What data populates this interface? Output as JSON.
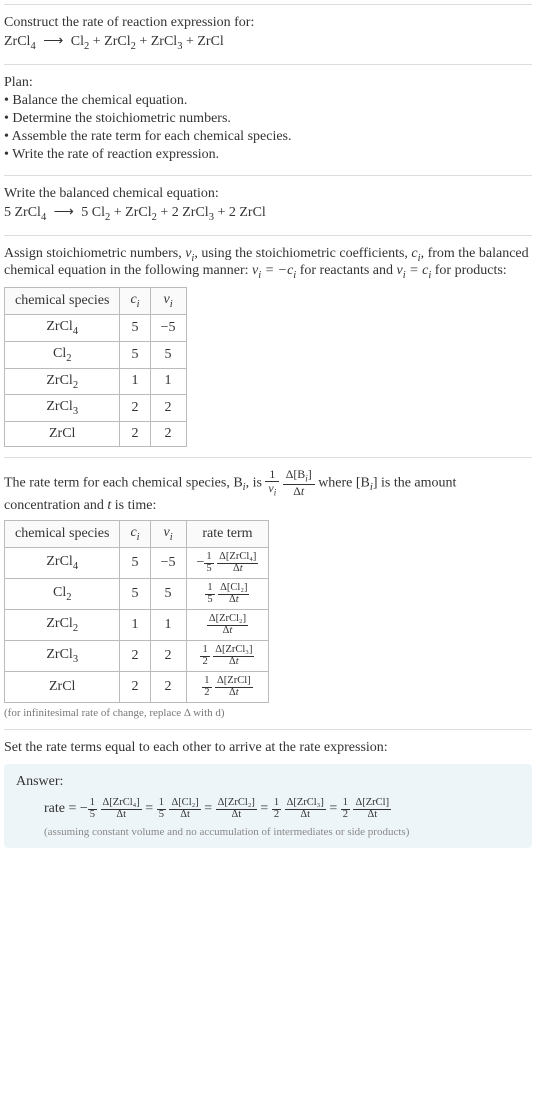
{
  "header": {
    "title": "Construct the rate of reaction expression for:",
    "equation_lhs": "ZrCl",
    "equation_rhs_parts": [
      "Cl",
      " + ZrCl",
      " + ZrCl",
      " + ZrCl"
    ]
  },
  "plan": {
    "title": "Plan:",
    "items": [
      "• Balance the chemical equation.",
      "• Determine the stoichiometric numbers.",
      "• Assemble the rate term for each chemical species.",
      "• Write the rate of reaction expression."
    ]
  },
  "balanced": {
    "title": "Write the balanced chemical equation:",
    "eq_text": "5 ZrCl₄  ⟶  5 Cl₂ + ZrCl₂ + 2 ZrCl₃ + 2 ZrCl"
  },
  "stoich": {
    "intro_a": "Assign stoichiometric numbers, ",
    "intro_b": ", using the stoichiometric coefficients, ",
    "intro_c": ", from the balanced chemical equation in the following manner: ",
    "intro_d": " for reactants and ",
    "intro_e": " for products:",
    "headers": [
      "chemical species",
      "cᵢ",
      "νᵢ"
    ],
    "rows": [
      {
        "species": "ZrCl",
        "sub": "4",
        "c": "5",
        "v": "−5"
      },
      {
        "species": "Cl",
        "sub": "2",
        "c": "5",
        "v": "5"
      },
      {
        "species": "ZrCl",
        "sub": "2",
        "c": "1",
        "v": "1"
      },
      {
        "species": "ZrCl",
        "sub": "3",
        "c": "2",
        "v": "2"
      },
      {
        "species": "ZrCl",
        "sub": "",
        "c": "2",
        "v": "2"
      }
    ]
  },
  "rateterm": {
    "intro_a": "The rate term for each chemical species, B",
    "intro_b": ", is ",
    "intro_c": " where [B",
    "intro_d": "] is the amount concentration and ",
    "intro_e": " is time:",
    "headers": [
      "chemical species",
      "cᵢ",
      "νᵢ",
      "rate term"
    ],
    "rows": [
      {
        "species": "ZrCl",
        "sub": "4",
        "c": "5",
        "v": "−5",
        "coef_sign": "−",
        "coef_num": "1",
        "coef_den": "5",
        "delta": "Δ[ZrCl₄]"
      },
      {
        "species": "Cl",
        "sub": "2",
        "c": "5",
        "v": "5",
        "coef_sign": "",
        "coef_num": "1",
        "coef_den": "5",
        "delta": "Δ[Cl₂]"
      },
      {
        "species": "ZrCl",
        "sub": "2",
        "c": "1",
        "v": "1",
        "coef_sign": "",
        "coef_num": "",
        "coef_den": "",
        "delta": "Δ[ZrCl₂]"
      },
      {
        "species": "ZrCl",
        "sub": "3",
        "c": "2",
        "v": "2",
        "coef_sign": "",
        "coef_num": "1",
        "coef_den": "2",
        "delta": "Δ[ZrCl₃]"
      },
      {
        "species": "ZrCl",
        "sub": "",
        "c": "2",
        "v": "2",
        "coef_sign": "",
        "coef_num": "1",
        "coef_den": "2",
        "delta": "Δ[ZrCl]"
      }
    ],
    "caption": "(for infinitesimal rate of change, replace Δ with d)"
  },
  "final": {
    "title": "Set the rate terms equal to each other to arrive at the rate expression:",
    "answer_title": "Answer:",
    "rate_label": "rate = ",
    "terms": [
      {
        "sign": "−",
        "num": "1",
        "den": "5",
        "delta": "Δ[ZrCl₄]"
      },
      {
        "sign": "",
        "num": "1",
        "den": "5",
        "delta": "Δ[Cl₂]"
      },
      {
        "sign": "",
        "num": "",
        "den": "",
        "delta": "Δ[ZrCl₂]"
      },
      {
        "sign": "",
        "num": "1",
        "den": "2",
        "delta": "Δ[ZrCl₃]"
      },
      {
        "sign": "",
        "num": "1",
        "den": "2",
        "delta": "Δ[ZrCl]"
      }
    ],
    "dt": "Δt",
    "note": "(assuming constant volume and no accumulation of intermediates or side products)"
  }
}
